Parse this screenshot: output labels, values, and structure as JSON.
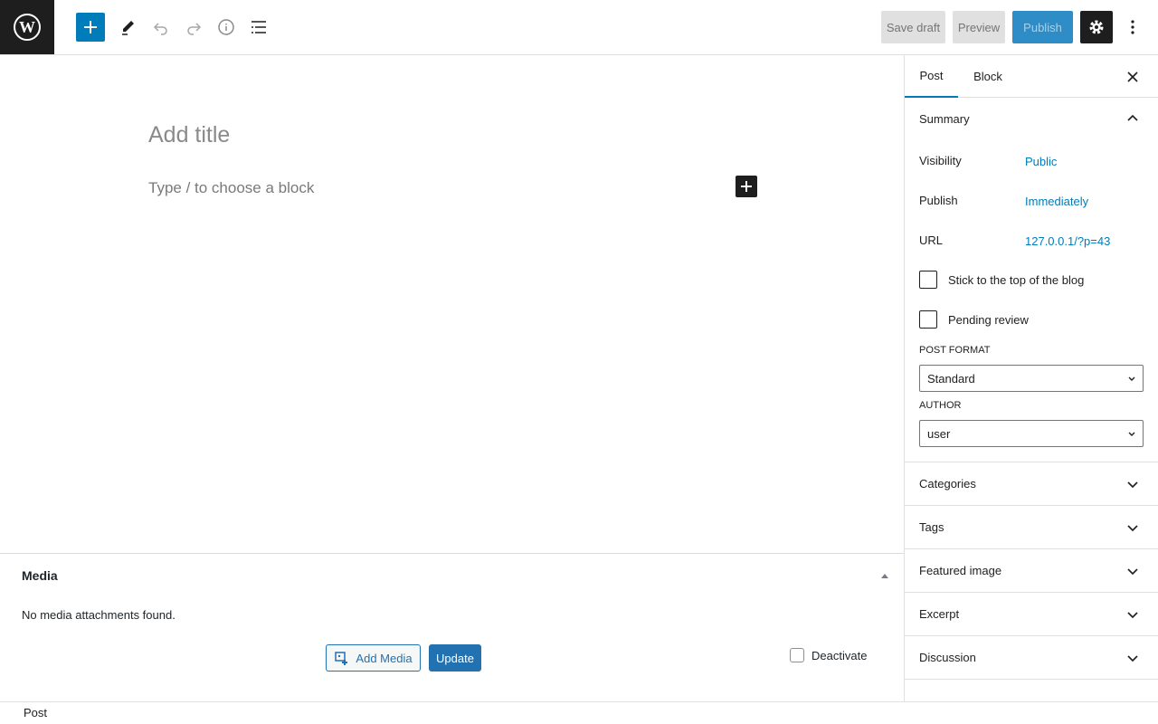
{
  "topbar": {
    "save_draft": "Save draft",
    "preview": "Preview",
    "publish": "Publish"
  },
  "editor": {
    "title_placeholder": "Add title",
    "block_placeholder": "Type / to choose a block"
  },
  "media": {
    "title": "Media",
    "empty": "No media attachments found.",
    "add_media": "Add Media",
    "update": "Update",
    "deactivate": "Deactivate"
  },
  "footer": {
    "breadcrumb": "Post"
  },
  "sidebar": {
    "tabs": [
      "Post",
      "Block"
    ],
    "summary": {
      "title": "Summary",
      "visibility_label": "Visibility",
      "visibility_value": "Public",
      "publish_label": "Publish",
      "publish_value": "Immediately",
      "url_label": "URL",
      "url_value": "127.0.0.1/?p=43",
      "stick_label": "Stick to the top of the blog",
      "pending_label": "Pending review",
      "post_format_label": "POST FORMAT",
      "post_format_value": "Standard",
      "author_label": "AUTHOR",
      "author_value": "user"
    },
    "panels": [
      "Categories",
      "Tags",
      "Featured image",
      "Excerpt",
      "Discussion"
    ]
  },
  "colors": {
    "accent": "#007cba",
    "wp_blue": "#2271b1",
    "dark": "#1e1e1e"
  },
  "icons": [
    "wordpress-logo-icon",
    "plus-icon",
    "pencil-icon",
    "undo-icon",
    "redo-icon",
    "info-icon",
    "list-view-icon",
    "gear-icon",
    "more-vertical-icon",
    "close-icon",
    "chevron-up-icon",
    "chevron-down-icon",
    "add-media-icon",
    "triangle-up-icon"
  ]
}
